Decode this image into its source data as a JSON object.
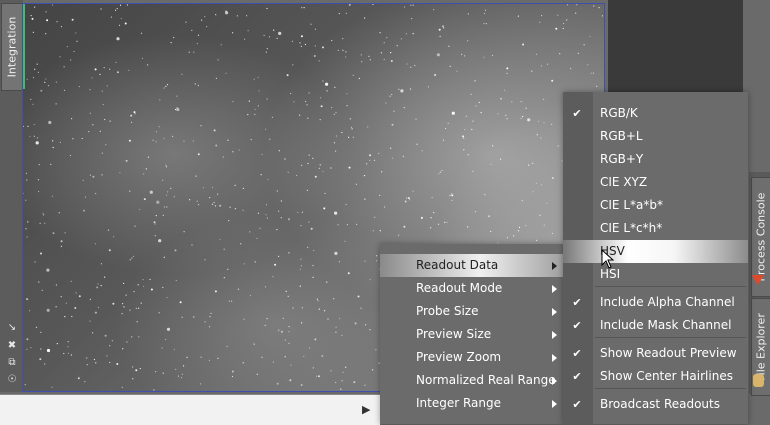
{
  "left_panel": {
    "tab_label": "Integration",
    "icons": [
      "shrink-icon",
      "expand-icon",
      "float-icon",
      "pin-icon"
    ]
  },
  "right_panel": {
    "tabs": [
      "Process Console",
      "File Explorer"
    ]
  },
  "context_menu": {
    "items": [
      {
        "label": "Readout Data",
        "submenu": true,
        "highlighted": true
      },
      {
        "label": "Readout Mode",
        "submenu": true
      },
      {
        "label": "Probe Size",
        "submenu": true
      },
      {
        "label": "Preview Size",
        "submenu": true
      },
      {
        "label": "Preview Zoom",
        "submenu": true
      },
      {
        "label": "Normalized Real Range",
        "submenu": true
      },
      {
        "label": "Integer Range",
        "submenu": true
      }
    ]
  },
  "readout_data_submenu": {
    "items": [
      {
        "label": "RGB/K",
        "checked": true
      },
      {
        "label": "RGB+L",
        "checked": false
      },
      {
        "label": "RGB+Y",
        "checked": false
      },
      {
        "label": "CIE XYZ",
        "checked": false
      },
      {
        "label": "CIE L*a*b*",
        "checked": false
      },
      {
        "label": "CIE L*c*h*",
        "checked": false
      },
      {
        "label": "HSV",
        "checked": false,
        "highlighted": true
      },
      {
        "label": "HSI",
        "checked": false
      },
      {
        "label": "Include Alpha Channel",
        "checked": true
      },
      {
        "label": "Include Mask Channel",
        "checked": true
      },
      {
        "label": "Show Readout Preview",
        "checked": true
      },
      {
        "label": "Show Center Hairlines",
        "checked": true
      },
      {
        "label": "Broadcast Readouts",
        "checked": true
      }
    ]
  },
  "colors": {
    "image_border": "#3f4fb0",
    "menu_bg": "#6b6b6b",
    "dark_panel": "#3a3a3a"
  }
}
